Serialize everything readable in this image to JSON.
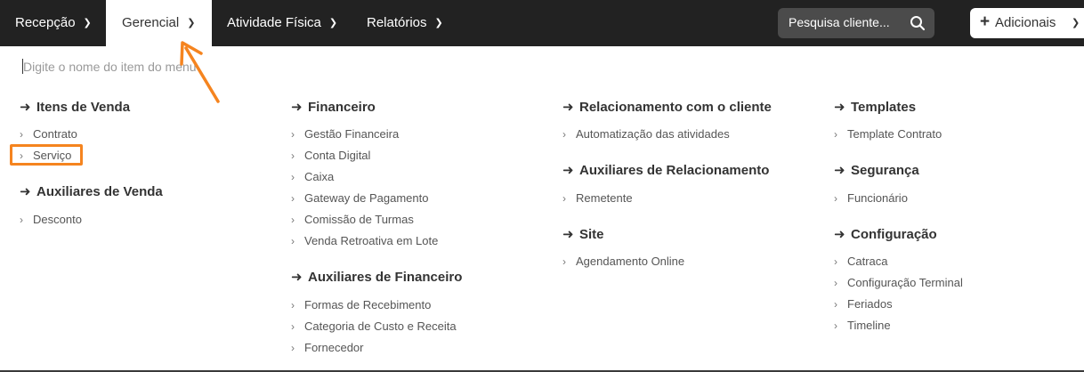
{
  "nav": {
    "items": [
      {
        "label": "Recepção",
        "active": false
      },
      {
        "label": "Gerencial",
        "active": true
      },
      {
        "label": "Atividade Física",
        "active": false
      },
      {
        "label": "Relatórios",
        "active": false
      }
    ],
    "search_placeholder": "Pesquisa cliente...",
    "add_label": "Adicionais"
  },
  "menu": {
    "search_placeholder": "Digite o nome do item do menu",
    "columns": [
      {
        "groups": [
          {
            "title": "Itens de Venda",
            "items": [
              "Contrato",
              "Serviço"
            ]
          },
          {
            "title": "Auxiliares de Venda",
            "items": [
              "Desconto"
            ]
          }
        ]
      },
      {
        "groups": [
          {
            "title": "Financeiro",
            "items": [
              "Gestão Financeira",
              "Conta Digital",
              "Caixa",
              "Gateway de Pagamento",
              "Comissão de Turmas",
              "Venda Retroativa em Lote"
            ]
          },
          {
            "title": "Auxiliares de Financeiro",
            "items": [
              "Formas de Recebimento",
              "Categoria de Custo e Receita",
              "Fornecedor"
            ]
          }
        ]
      },
      {
        "groups": [
          {
            "title": "Relacionamento com o cliente",
            "items": [
              "Automatização das atividades"
            ]
          },
          {
            "title": "Auxiliares de Relacionamento",
            "items": [
              "Remetente"
            ]
          },
          {
            "title": "Site",
            "items": [
              "Agendamento Online"
            ]
          }
        ]
      },
      {
        "groups": [
          {
            "title": "Templates",
            "items": [
              "Template Contrato"
            ]
          },
          {
            "title": "Segurança",
            "items": [
              "Funcionário"
            ]
          },
          {
            "title": "Configuração",
            "items": [
              "Catraca",
              "Configuração Terminal",
              "Feriados",
              "Timeline"
            ]
          }
        ]
      }
    ]
  },
  "colors": {
    "topbar": "#222222",
    "annotation": "#f5841f"
  },
  "icons": {
    "search": "search-icon",
    "plus": "plus-icon",
    "chevron": "chevron-down-icon",
    "arrow": "arrow-right-icon"
  }
}
